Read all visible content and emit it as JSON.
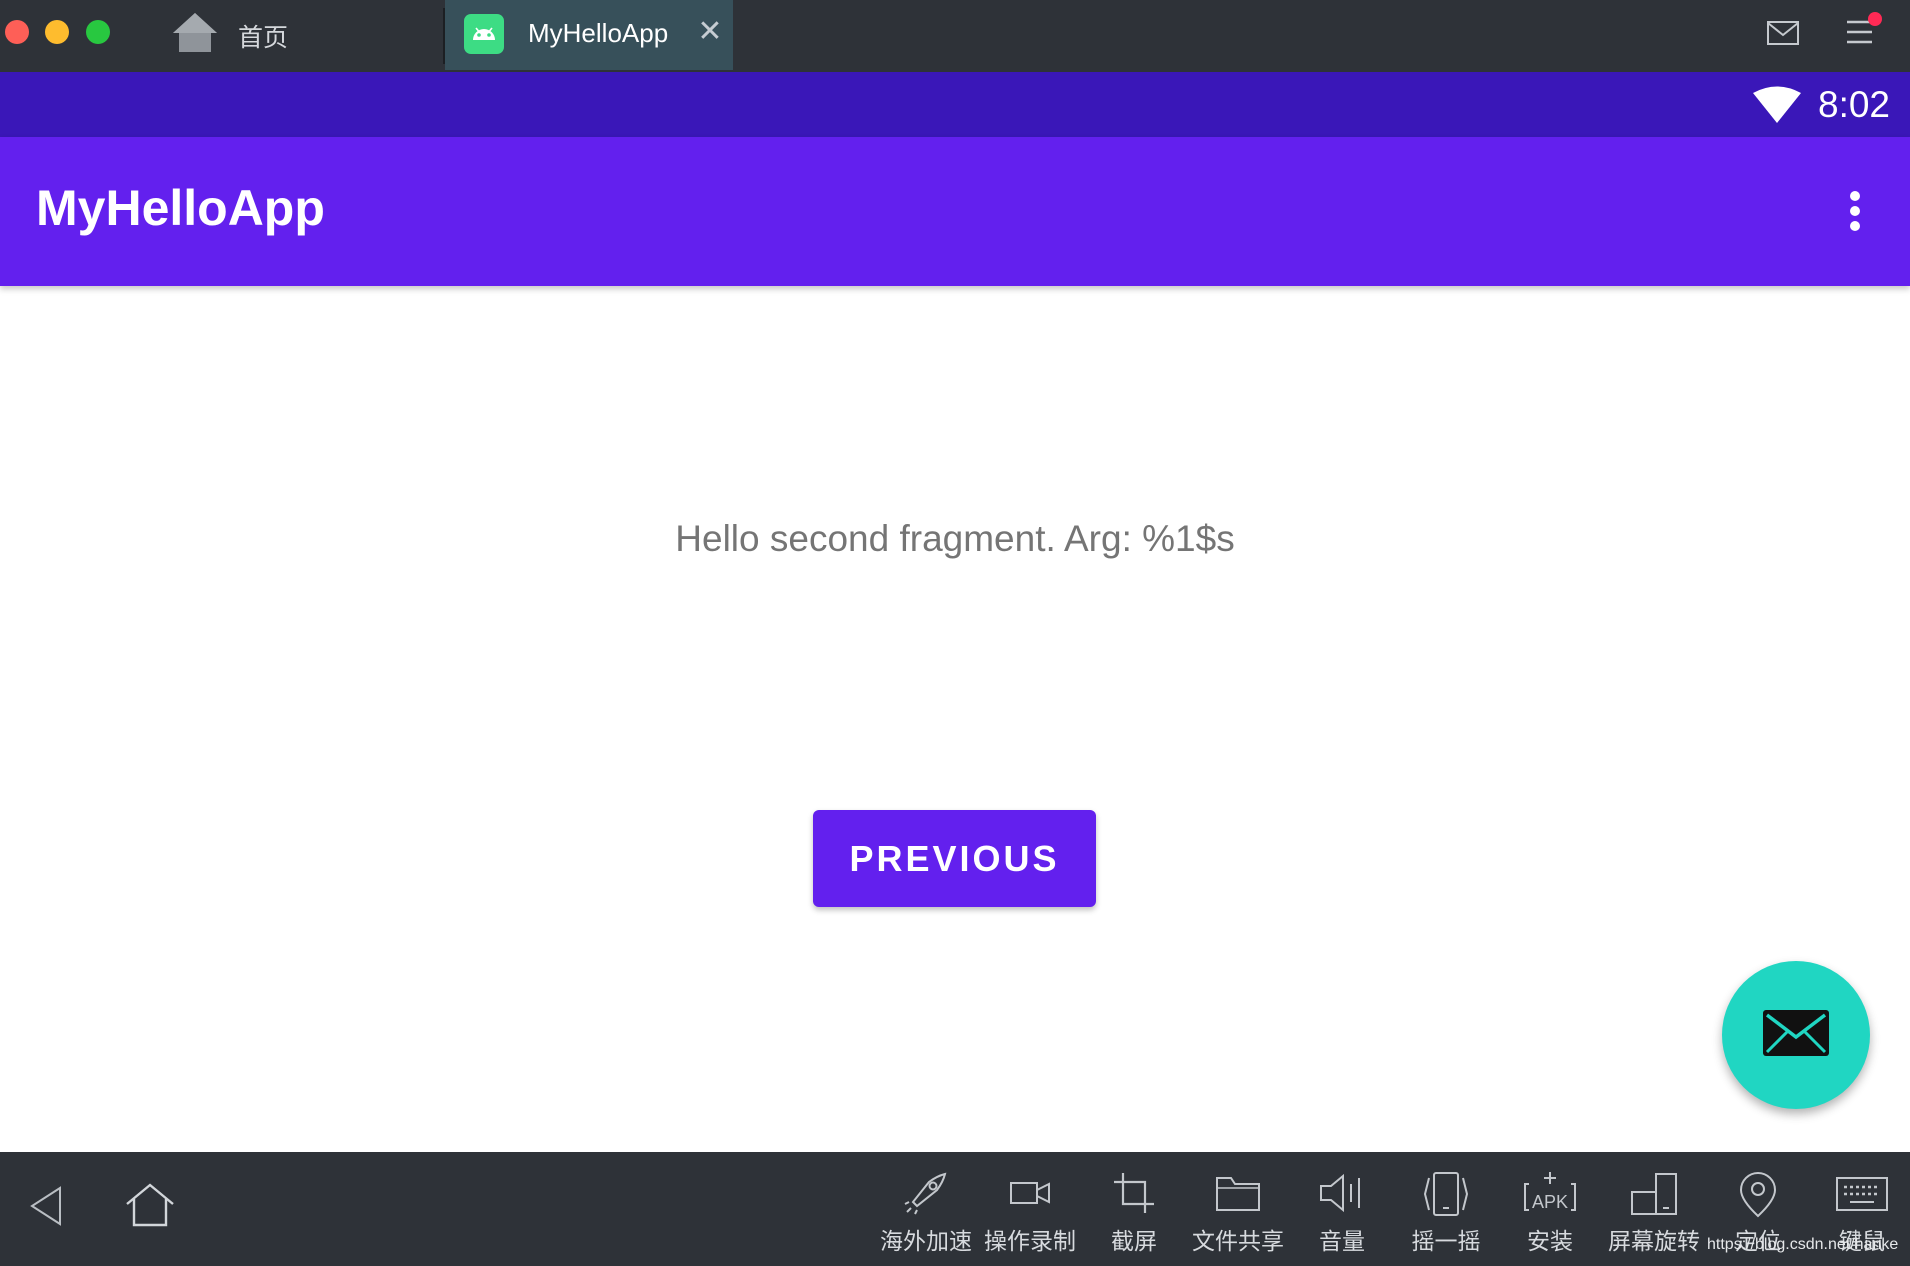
{
  "window": {
    "tabs": [
      {
        "label": "首页",
        "icon": "home-icon"
      },
      {
        "label": "MyHelloApp",
        "icon": "android-app-icon",
        "close": "✕"
      }
    ],
    "header_icons": [
      "mail-icon",
      "menu-icon"
    ],
    "notification_dot_color": "#ff2a55"
  },
  "status_bar": {
    "time": "8:02",
    "icons": [
      "wifi-icon"
    ],
    "color": "#3a17b8"
  },
  "app_bar": {
    "title": "MyHelloApp",
    "color": "#6320ee",
    "overflow_icon": "more-vert-icon"
  },
  "content": {
    "message": "Hello second fragment. Arg: %1$s",
    "previous_button": "PREVIOUS"
  },
  "fab": {
    "icon": "email-icon",
    "color": "#20d6c2"
  },
  "bottom_toolbar": {
    "nav": [
      "back-icon",
      "home-icon"
    ],
    "tools": [
      {
        "label": "海外加速",
        "icon": "rocket-icon"
      },
      {
        "label": "操作录制",
        "icon": "video-camera-icon"
      },
      {
        "label": "截屏",
        "icon": "crop-icon"
      },
      {
        "label": "文件共享",
        "icon": "folder-icon"
      },
      {
        "label": "音量",
        "icon": "volume-icon"
      },
      {
        "label": "摇一摇",
        "icon": "shake-icon"
      },
      {
        "label": "安装",
        "icon": "apk-install-icon"
      },
      {
        "label": "屏幕旋转",
        "icon": "rotate-screen-icon"
      },
      {
        "label": "定位",
        "icon": "location-icon"
      },
      {
        "label": "键鼠",
        "icon": "keyboard-icon"
      }
    ]
  },
  "watermark": "https://blog.csdn.net/hanke"
}
